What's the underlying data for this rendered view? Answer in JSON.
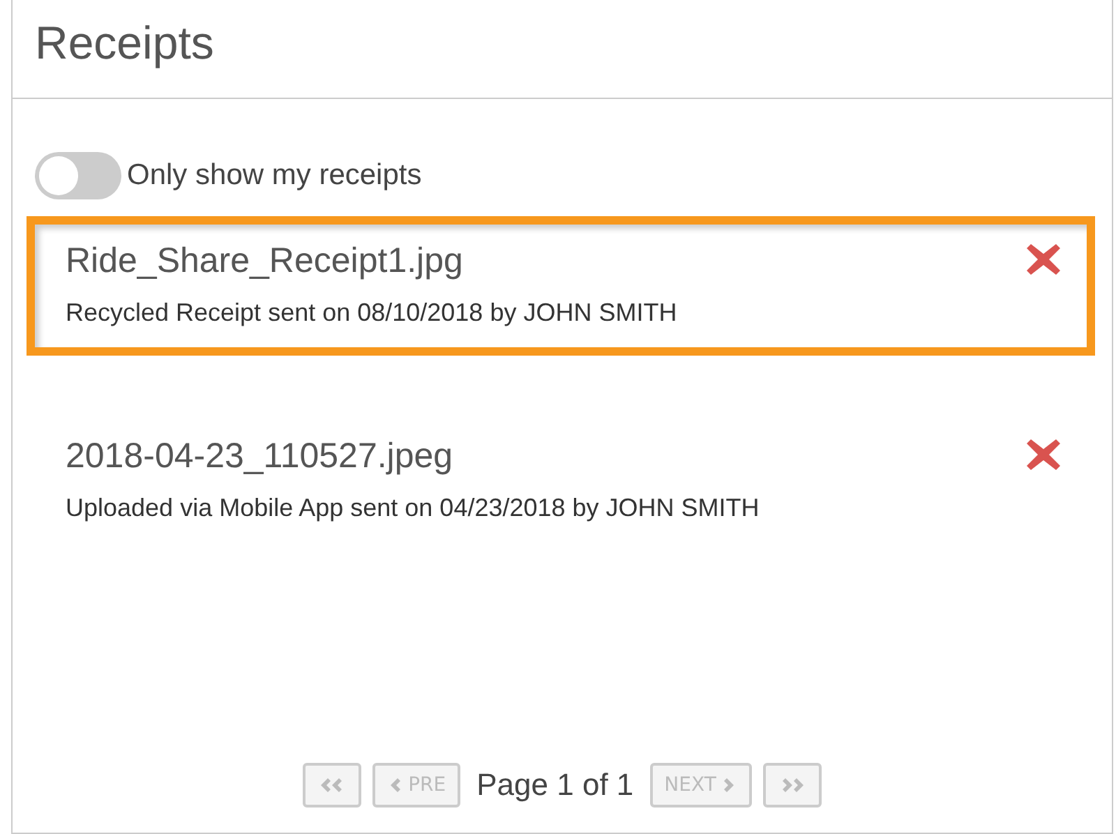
{
  "panel": {
    "title": "Receipts"
  },
  "toggle": {
    "label": "Only show my receipts",
    "on": false
  },
  "receipts": [
    {
      "name": "Ride_Share_Receipt1.jpg",
      "detail": "Recycled Receipt sent on 08/10/2018 by JOHN SMITH",
      "selected": true
    },
    {
      "name": "2018-04-23_110527.jpeg",
      "detail": "Uploaded via Mobile App sent on 04/23/2018 by JOHN SMITH",
      "selected": false
    }
  ],
  "pager": {
    "first": {
      "kind": "first",
      "disabled": true
    },
    "prev": {
      "kind": "prev",
      "label": "PRE",
      "disabled": true
    },
    "status": "Page 1 of 1",
    "next": {
      "kind": "next",
      "label": "NEXT",
      "disabled": true
    },
    "last": {
      "kind": "last",
      "disabled": true
    }
  }
}
